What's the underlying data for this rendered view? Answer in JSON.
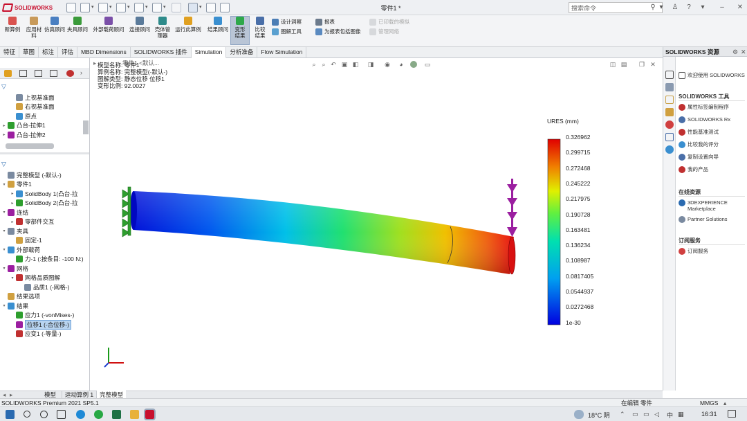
{
  "app": {
    "brand": "SOLIDWORKS",
    "doc_title": "零件1 *"
  },
  "search": {
    "placeholder": "搜索命令"
  },
  "commands": {
    "new_study": "新算例",
    "apply_material": "应用材料",
    "simulation_advisor": "仿真顾问",
    "fixtures_advisor": "夹具顾问",
    "external_loads_advisor": "外部载荷顾问",
    "connections_advisor": "连接顾问",
    "shell_manager": "壳体管理器",
    "run_study": "运行此算例",
    "results_advisor": "结果顾问",
    "deformed_result": "变形结果",
    "compare_results": "比较结果",
    "design_insight": "设计洞察",
    "plot_tools": "图解工具",
    "report": "报表",
    "include_image": "为报表包括图像",
    "uploaded_sim": "已印载的模拟",
    "manage_network": "管理网络"
  },
  "tabs": [
    "特征",
    "草图",
    "标注",
    "评估",
    "MBD Dimensions",
    "SOLIDWORKS 插件",
    "Simulation",
    "分析准备",
    "Flow Simulation"
  ],
  "active_tab": "Simulation",
  "feature_tree": [
    {
      "label": "上视基准面",
      "indent": 1,
      "arrow": ""
    },
    {
      "label": "右视基准面",
      "indent": 1,
      "arrow": ""
    },
    {
      "label": "原点",
      "indent": 1,
      "arrow": ""
    },
    {
      "label": "凸台-拉伸1",
      "indent": 0,
      "arrow": "▸"
    },
    {
      "label": "凸台-拉伸2",
      "indent": 0,
      "arrow": "▸"
    }
  ],
  "sim_tree": [
    {
      "label": "完整模型 (-默认-)",
      "indent": 0,
      "arrow": ""
    },
    {
      "label": "零件1",
      "indent": 0,
      "arrow": "▾"
    },
    {
      "label": "SolidBody 1(凸台-拉",
      "indent": 1,
      "arrow": "▸"
    },
    {
      "label": "SolidBody 2(凸台-拉",
      "indent": 1,
      "arrow": "▸"
    },
    {
      "label": "连结",
      "indent": 0,
      "arrow": "▾"
    },
    {
      "label": "零部件交互",
      "indent": 1,
      "arrow": "▸"
    },
    {
      "label": "夹具",
      "indent": 0,
      "arrow": "▾"
    },
    {
      "label": "固定-1",
      "indent": 1,
      "arrow": ""
    },
    {
      "label": "外部载荷",
      "indent": 0,
      "arrow": "▾"
    },
    {
      "label": "力-1 (:按条目: -100 N:)",
      "indent": 1,
      "arrow": ""
    },
    {
      "label": "网格",
      "indent": 0,
      "arrow": "▾"
    },
    {
      "label": "网格品质图解",
      "indent": 1,
      "arrow": "▾"
    },
    {
      "label": "品质1 (-网格-)",
      "indent": 2,
      "arrow": ""
    },
    {
      "label": "结果选项",
      "indent": 0,
      "arrow": ""
    },
    {
      "label": "结果",
      "indent": 0,
      "arrow": "▾"
    },
    {
      "label": "应力1 (-vonMises-)",
      "indent": 1,
      "arrow": ""
    },
    {
      "label": "位移1 (-合位移-)",
      "indent": 1,
      "arrow": "",
      "selected": true
    },
    {
      "label": "应变1 (-等量-)",
      "indent": 1,
      "arrow": ""
    }
  ],
  "plot_info": {
    "line0": "模型名称: 零件1",
    "line1": "算例名称: 完整模型(-默认-)",
    "line2": "图解类型: 静态位移 位移1",
    "line3": "变形比例: 92.0027",
    "overlap": "零件1 <默认..."
  },
  "legend": {
    "title": "URES (mm)",
    "values": [
      "0.326962",
      "0.299715",
      "0.272468",
      "0.245222",
      "0.217975",
      "0.190728",
      "0.163481",
      "0.136234",
      "0.108987",
      "0.0817405",
      "0.0544937",
      "0.0272468",
      "1e-30"
    ]
  },
  "task_pane": {
    "title": "SOLIDWORKS 资源",
    "welcome": "欢迎使用 SOLIDWORKS",
    "tools_header": "SOLIDWORKS 工具",
    "tools": [
      "属性标签编制程序",
      "SOLIDWORKS Rx",
      "性能基准测试",
      "比较我的评分",
      "复制设置向导",
      "我的产品"
    ],
    "online_header": "在线资源",
    "online": [
      "3DEXPERIENCE Marketplace",
      "Partner Solutions"
    ],
    "sub_header": "订阅服务",
    "sub": [
      "订阅服务"
    ]
  },
  "bottom_tabs": [
    "模型",
    "运动算例 1",
    "完整模型"
  ],
  "status": {
    "version": "SOLIDWORKS Premium 2021 SP5.1",
    "editing": "在编辑 零件",
    "units": "MMGS"
  },
  "taskbar": {
    "weather": "18°C 阴",
    "ime": "中",
    "time": "16:31"
  },
  "colors": {
    "accent": "#c8102e",
    "selection": "#b8d4f0",
    "load": "#9b1fa0",
    "fixture": "#2e9e2e"
  }
}
